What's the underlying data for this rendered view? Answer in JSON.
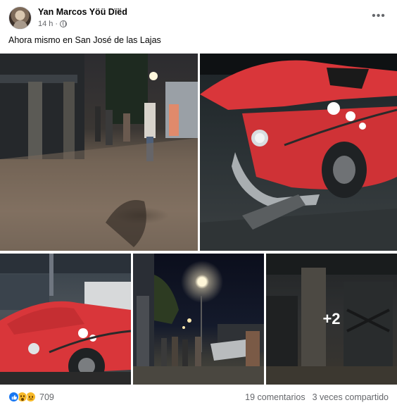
{
  "post": {
    "author": "Yan Marcos Yöü Dïëd",
    "time": "14 h",
    "time_separator": "·",
    "audience_icon": "globe-icon",
    "more_icon": "more-options-icon",
    "more_label": "•••",
    "text": "Ahora mismo en San José de las Lajas"
  },
  "photos": {
    "count": 5,
    "extra_label": "+2"
  },
  "footer": {
    "reactions": [
      "like",
      "wow",
      "sad"
    ],
    "reaction_count": "709",
    "comments": "19 comentarios",
    "shares": "3 veces compartido"
  },
  "colors": {
    "car_red": "#d9363a",
    "secondary_text": "#65676b",
    "like_blue": "#1877f2",
    "reaction_yellow": "#f7b928"
  }
}
